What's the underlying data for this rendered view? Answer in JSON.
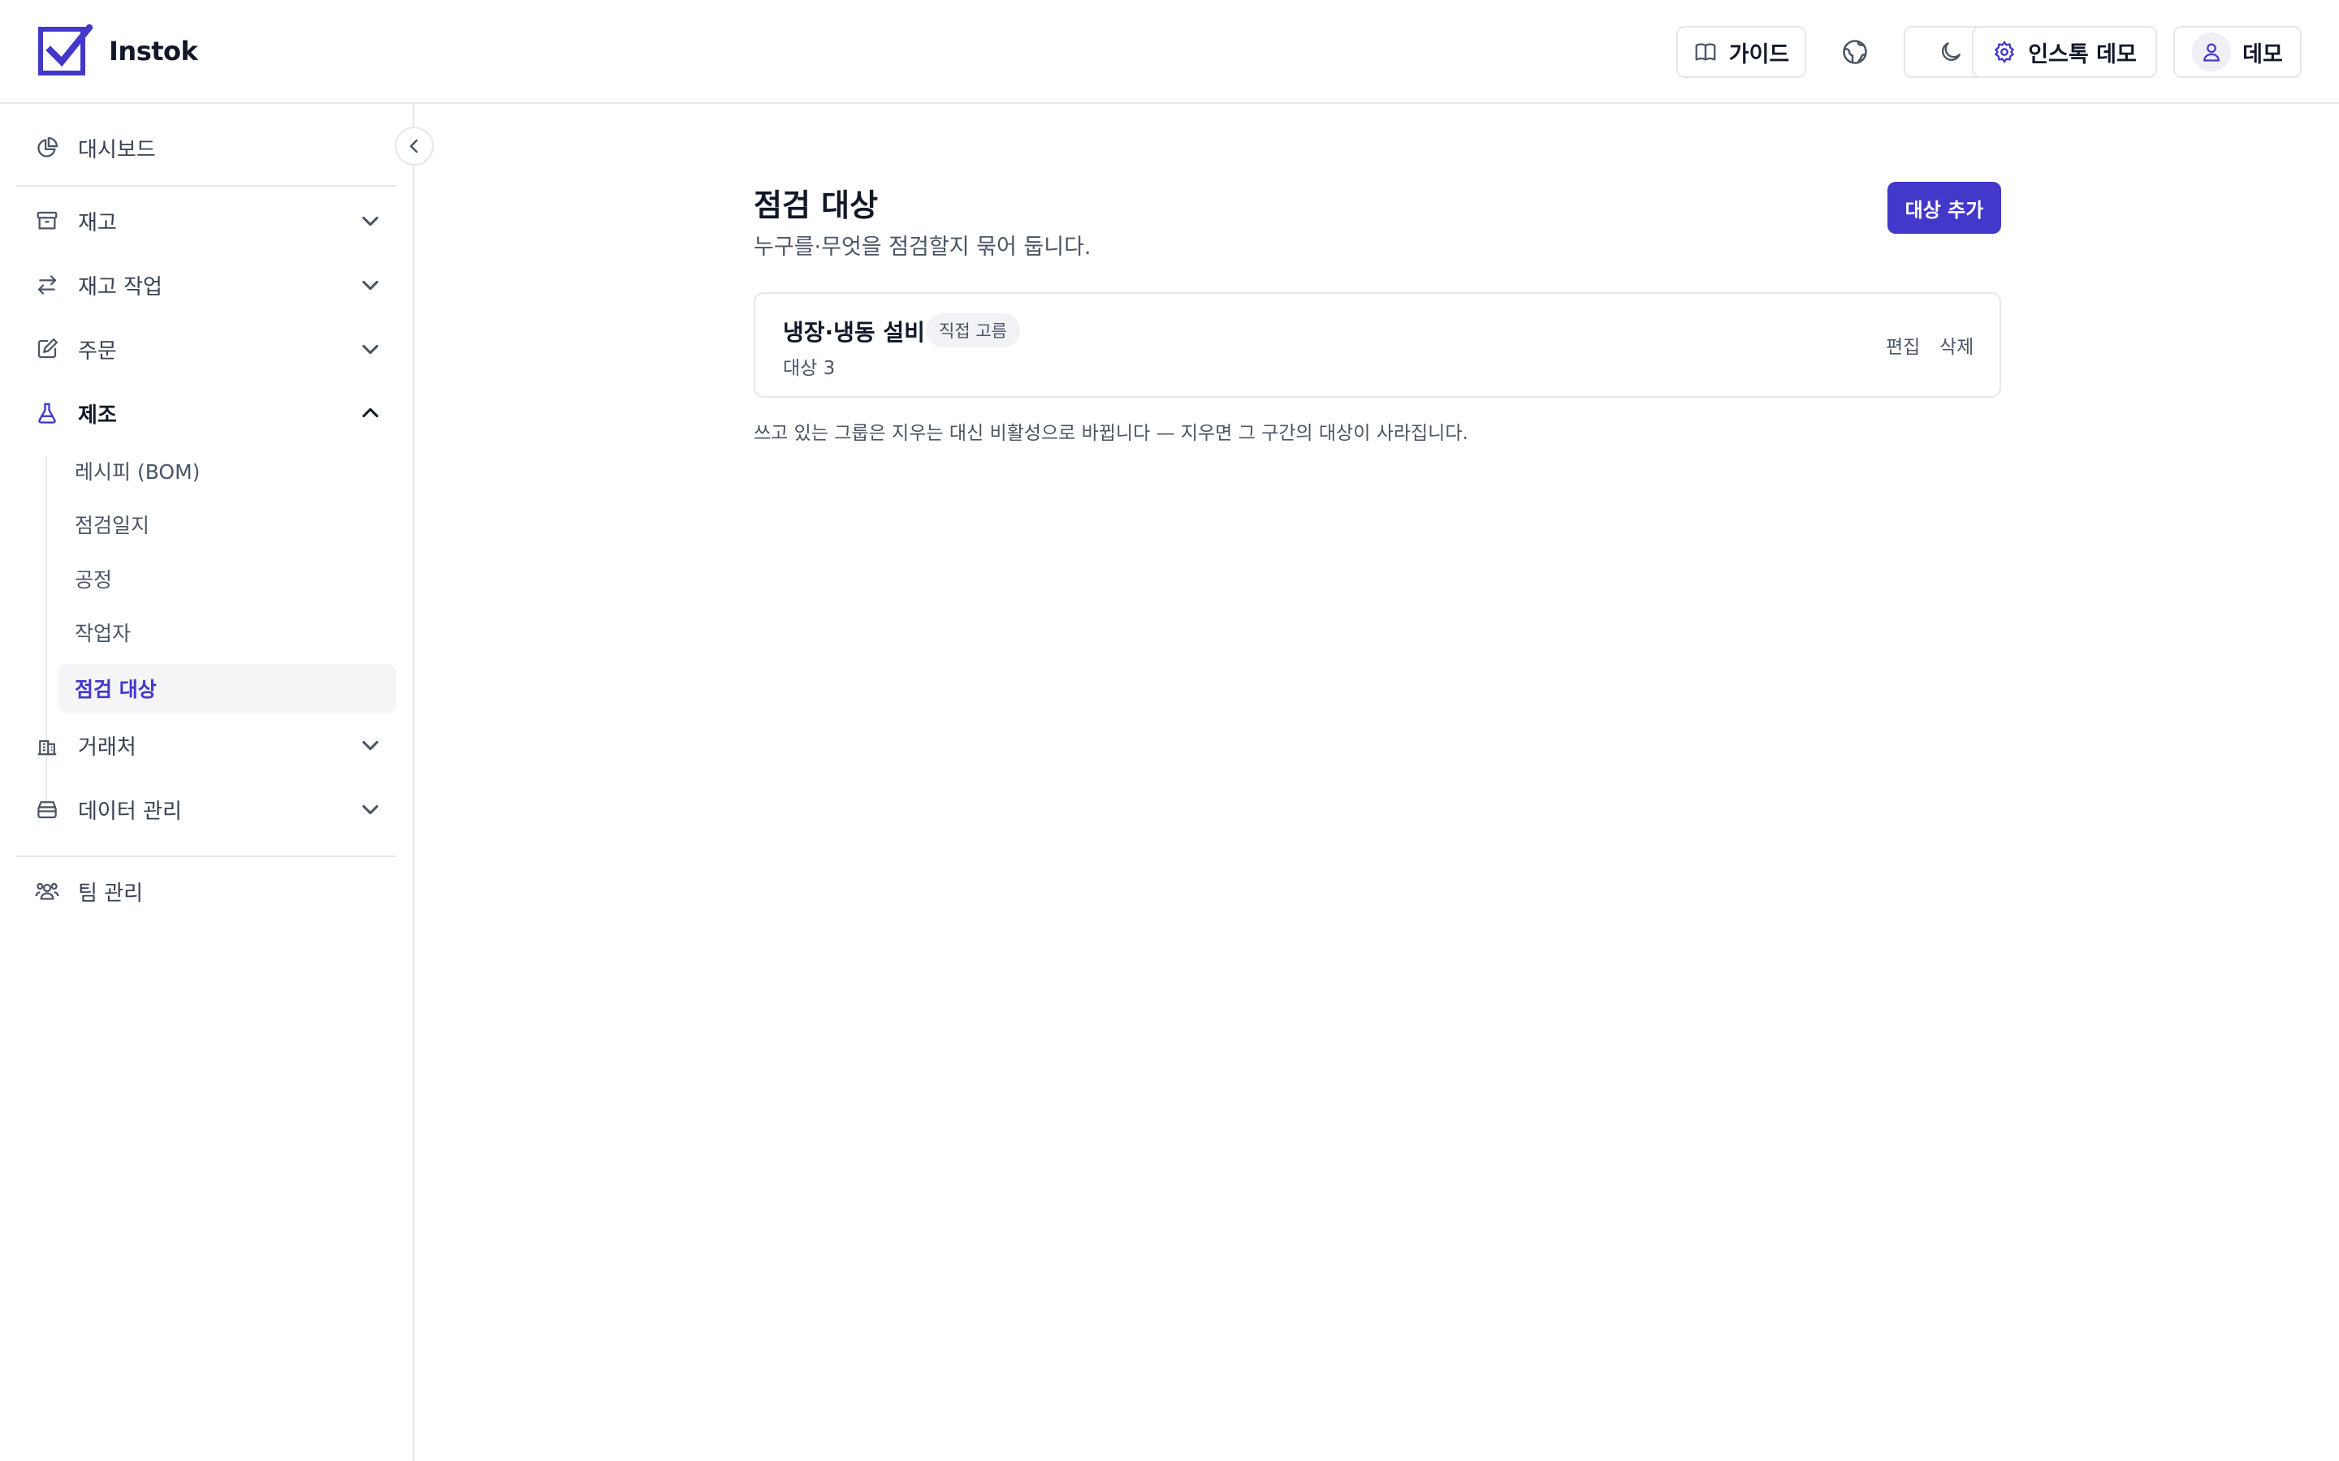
{
  "app": {
    "name": "Instok",
    "accent": "#4338ca"
  },
  "header": {
    "guide_label": "가이드",
    "settings_label": "인스톡 데모",
    "user_label": "데모"
  },
  "sidebar": {
    "dashboard": "대시보드",
    "inventory": "재고",
    "inventory_ops": "재고 작업",
    "orders": "주문",
    "manufacturing": "제조",
    "manufacturing_items": [
      "레시피 (BOM)",
      "점검일지",
      "공정",
      "작업자",
      "점검 대상"
    ],
    "active_item": "점검 대상",
    "partners": "거래처",
    "data_management": "데이터 관리",
    "team": "팀 관리"
  },
  "main": {
    "title": "점검 대상",
    "subtitle": "누구를·무엇을 점검할지 묶어 둡니다.",
    "add_button": "대상 추가",
    "groups": [
      {
        "name": "냉장·냉동 설비",
        "badge": "직접 고름",
        "count": "대상 3",
        "edit": "편집",
        "delete": "삭제"
      }
    ],
    "note": "쓰고 있는 그룹은 지우는 대신 비활성으로 바뀝니다 — 지우면 그 구간의 대상이 사라집니다."
  }
}
